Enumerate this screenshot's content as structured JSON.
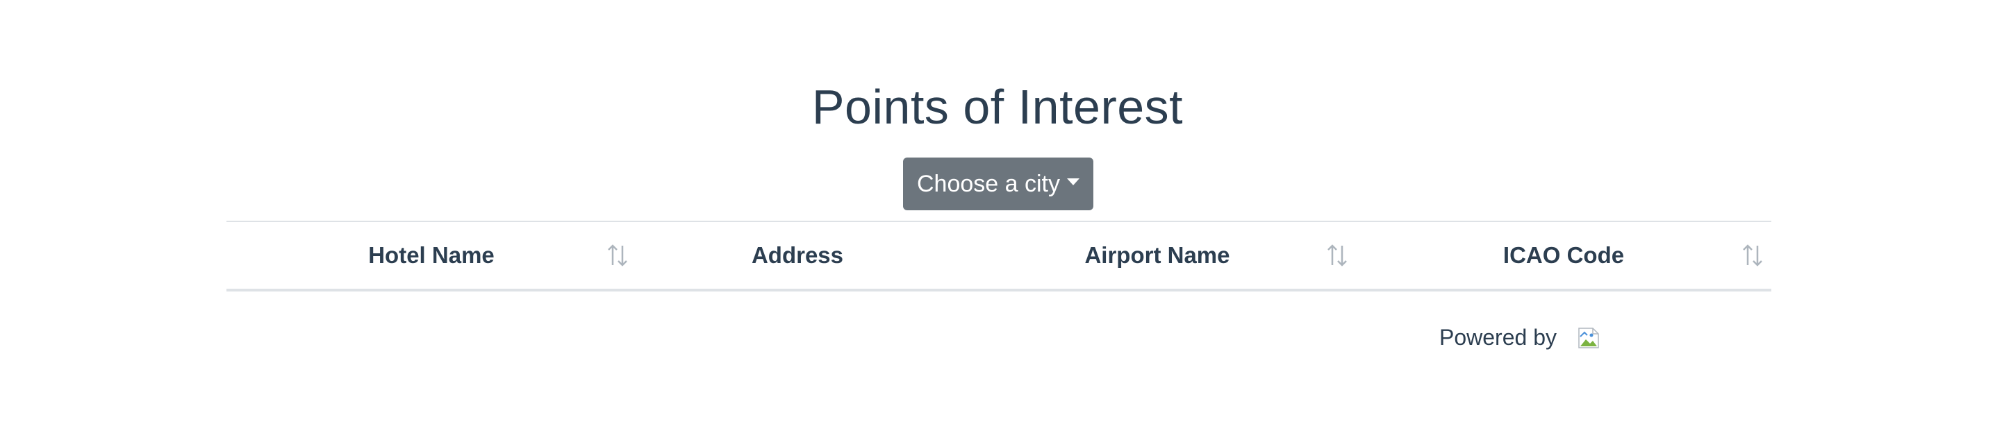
{
  "page": {
    "title": "Points of Interest"
  },
  "city_dropdown": {
    "label": "Choose a city"
  },
  "table": {
    "columns": [
      {
        "label": "Hotel Name",
        "sortable": true
      },
      {
        "label": "Address",
        "sortable": false
      },
      {
        "label": "Airport Name",
        "sortable": true
      },
      {
        "label": "ICAO Code",
        "sortable": true
      }
    ],
    "rows": []
  },
  "footer": {
    "powered_by": "Powered by",
    "logo_icon": "broken-image-icon"
  },
  "colors": {
    "text": "#2c3e50",
    "button_bg": "#6c757d",
    "border": "#dee2e6",
    "sort_icon": "#adb5bd"
  }
}
